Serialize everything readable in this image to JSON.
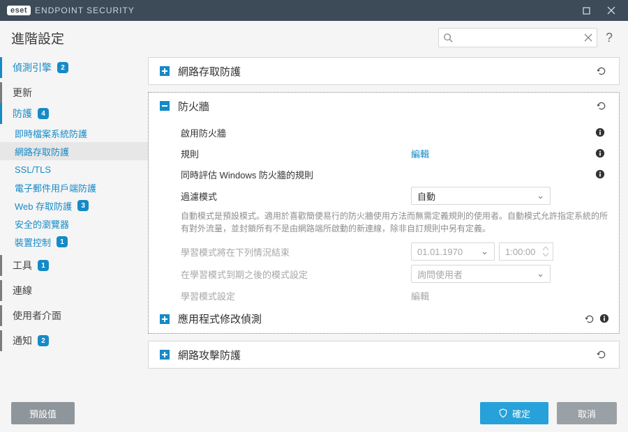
{
  "app": {
    "brand_badge": "eset",
    "brand_name": "ENDPOINT SECURITY",
    "page_title": "進階設定",
    "search_placeholder": ""
  },
  "sidebar": [
    {
      "label": "偵測引擎",
      "badge": "2",
      "type": "top",
      "accent": true
    },
    {
      "label": "更新",
      "type": "top"
    },
    {
      "label": "防護",
      "badge": "4",
      "type": "top",
      "accent": true
    },
    {
      "label": "即時檔案系統防護",
      "type": "child",
      "accent": true
    },
    {
      "label": "網路存取防護",
      "type": "child",
      "accent": true,
      "selected": true
    },
    {
      "label": "SSL/TLS",
      "type": "child",
      "accent": true
    },
    {
      "label": "電子郵件用戶端防護",
      "type": "child",
      "accent": true
    },
    {
      "label": "Web 存取防護",
      "badge": "3",
      "type": "child",
      "accent": true
    },
    {
      "label": "安全的瀏覽器",
      "type": "child",
      "accent": true
    },
    {
      "label": "裝置控制",
      "badge": "1",
      "type": "child",
      "accent": true
    },
    {
      "label": "工具",
      "badge": "1",
      "type": "top"
    },
    {
      "label": "連線",
      "type": "top"
    },
    {
      "label": "使用者介面",
      "type": "top"
    },
    {
      "label": "通知",
      "badge": "2",
      "type": "top"
    }
  ],
  "panels": {
    "p0": {
      "title": "網路存取防護"
    },
    "firewall": {
      "title": "防火牆",
      "enable_label": "啟用防火牆",
      "enable_value": true,
      "rules_label": "規則",
      "rules_action": "編輯",
      "winfw_label": "同時評估 Windows 防火牆的規則",
      "winfw_value": false,
      "filter_label": "過濾模式",
      "filter_value": "自動",
      "filter_desc": "自動模式是預設模式。適用於喜歡簡便易行的防火牆使用方法而無需定義規則的使用者。自動模式允許指定系統的所有對外流量，並封鎖所有不是由網路端所啟動的新連線，除非自訂規則中另有定義。",
      "learn_end_label": "學習模式將在下列情況結束",
      "learn_end_date": "01.01.1970",
      "learn_end_time": "1:00:00",
      "learn_after_label": "在學習模式到期之後的模式設定",
      "learn_after_value": "詢問使用者",
      "learn_settings_label": "學習模式設定",
      "learn_settings_action": "編輯",
      "sub_title": "應用程式修改偵測"
    },
    "p2": {
      "title": "網路攻擊防護"
    }
  },
  "footer": {
    "defaults": "預設值",
    "ok": "確定",
    "cancel": "取消"
  }
}
